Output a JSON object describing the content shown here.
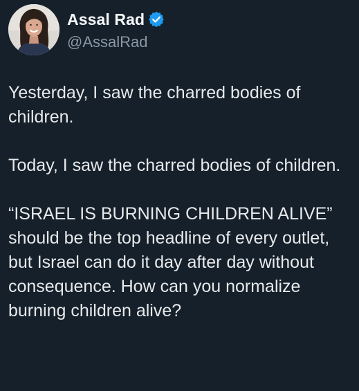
{
  "author": {
    "display_name": "Assal Rad",
    "handle": "@AssalRad",
    "verified": true,
    "avatar": "profile-photo",
    "verified_icon": "verified-badge-icon",
    "badge_color": "#1d9bf0"
  },
  "tweet": {
    "paragraphs": [
      "Yesterday, I saw the charred bodies of children.",
      "Today, I saw the charred bodies of children.",
      "“ISRAEL IS BURNING CHILDREN ALIVE” should be the top headline of every outlet, but Israel can do it day after day without consequence. How can you normalize burning children alive?"
    ]
  },
  "theme": {
    "background": "#15202b",
    "text": "#e7e9ea",
    "secondary_text": "#8b98a5"
  }
}
